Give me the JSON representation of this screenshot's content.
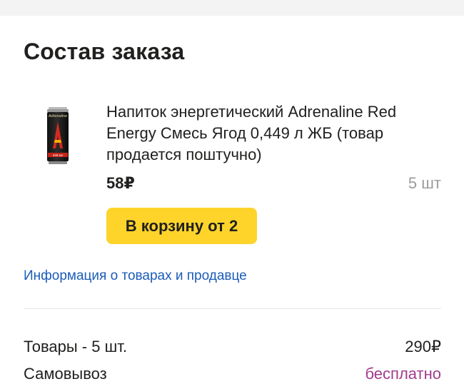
{
  "order": {
    "title": "Состав заказа"
  },
  "product": {
    "name": "Напиток энергетический Adrenaline Red Energy Смесь Ягод 0,449 л ЖБ (товар продается поштучно)",
    "price": "58₽",
    "quantity": "5 шт",
    "image_icon": "energy-drink-can",
    "can_brand": "Adrenaline",
    "can_volume": "449 мл",
    "button_label": "В корзину от 2",
    "button_color": "#fed42b"
  },
  "info_link": "Информация о товарах и продавце",
  "summary": {
    "goods_label": "Товары - 5 шт.",
    "goods_value": "290₽",
    "delivery_label": "Самовывоз",
    "delivery_value": "бесплатно"
  },
  "colors": {
    "link": "#1b5cb8",
    "free": "#a23b8d",
    "muted": "#9b9b9b"
  }
}
